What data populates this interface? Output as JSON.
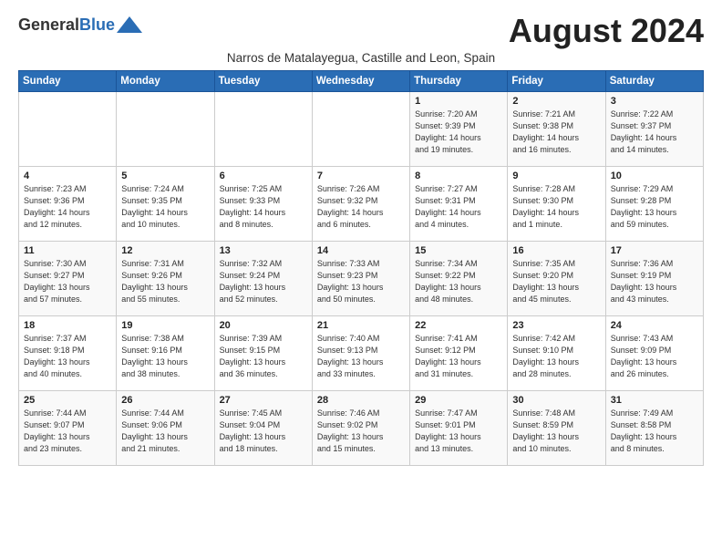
{
  "logo": {
    "general": "General",
    "blue": "Blue"
  },
  "title": "August 2024",
  "subtitle": "Narros de Matalayegua, Castille and Leon, Spain",
  "days_header": [
    "Sunday",
    "Monday",
    "Tuesday",
    "Wednesday",
    "Thursday",
    "Friday",
    "Saturday"
  ],
  "weeks": [
    [
      {
        "day": "",
        "info": ""
      },
      {
        "day": "",
        "info": ""
      },
      {
        "day": "",
        "info": ""
      },
      {
        "day": "",
        "info": ""
      },
      {
        "day": "1",
        "info": "Sunrise: 7:20 AM\nSunset: 9:39 PM\nDaylight: 14 hours\nand 19 minutes."
      },
      {
        "day": "2",
        "info": "Sunrise: 7:21 AM\nSunset: 9:38 PM\nDaylight: 14 hours\nand 16 minutes."
      },
      {
        "day": "3",
        "info": "Sunrise: 7:22 AM\nSunset: 9:37 PM\nDaylight: 14 hours\nand 14 minutes."
      }
    ],
    [
      {
        "day": "4",
        "info": "Sunrise: 7:23 AM\nSunset: 9:36 PM\nDaylight: 14 hours\nand 12 minutes."
      },
      {
        "day": "5",
        "info": "Sunrise: 7:24 AM\nSunset: 9:35 PM\nDaylight: 14 hours\nand 10 minutes."
      },
      {
        "day": "6",
        "info": "Sunrise: 7:25 AM\nSunset: 9:33 PM\nDaylight: 14 hours\nand 8 minutes."
      },
      {
        "day": "7",
        "info": "Sunrise: 7:26 AM\nSunset: 9:32 PM\nDaylight: 14 hours\nand 6 minutes."
      },
      {
        "day": "8",
        "info": "Sunrise: 7:27 AM\nSunset: 9:31 PM\nDaylight: 14 hours\nand 4 minutes."
      },
      {
        "day": "9",
        "info": "Sunrise: 7:28 AM\nSunset: 9:30 PM\nDaylight: 14 hours\nand 1 minute."
      },
      {
        "day": "10",
        "info": "Sunrise: 7:29 AM\nSunset: 9:28 PM\nDaylight: 13 hours\nand 59 minutes."
      }
    ],
    [
      {
        "day": "11",
        "info": "Sunrise: 7:30 AM\nSunset: 9:27 PM\nDaylight: 13 hours\nand 57 minutes."
      },
      {
        "day": "12",
        "info": "Sunrise: 7:31 AM\nSunset: 9:26 PM\nDaylight: 13 hours\nand 55 minutes."
      },
      {
        "day": "13",
        "info": "Sunrise: 7:32 AM\nSunset: 9:24 PM\nDaylight: 13 hours\nand 52 minutes."
      },
      {
        "day": "14",
        "info": "Sunrise: 7:33 AM\nSunset: 9:23 PM\nDaylight: 13 hours\nand 50 minutes."
      },
      {
        "day": "15",
        "info": "Sunrise: 7:34 AM\nSunset: 9:22 PM\nDaylight: 13 hours\nand 48 minutes."
      },
      {
        "day": "16",
        "info": "Sunrise: 7:35 AM\nSunset: 9:20 PM\nDaylight: 13 hours\nand 45 minutes."
      },
      {
        "day": "17",
        "info": "Sunrise: 7:36 AM\nSunset: 9:19 PM\nDaylight: 13 hours\nand 43 minutes."
      }
    ],
    [
      {
        "day": "18",
        "info": "Sunrise: 7:37 AM\nSunset: 9:18 PM\nDaylight: 13 hours\nand 40 minutes."
      },
      {
        "day": "19",
        "info": "Sunrise: 7:38 AM\nSunset: 9:16 PM\nDaylight: 13 hours\nand 38 minutes."
      },
      {
        "day": "20",
        "info": "Sunrise: 7:39 AM\nSunset: 9:15 PM\nDaylight: 13 hours\nand 36 minutes."
      },
      {
        "day": "21",
        "info": "Sunrise: 7:40 AM\nSunset: 9:13 PM\nDaylight: 13 hours\nand 33 minutes."
      },
      {
        "day": "22",
        "info": "Sunrise: 7:41 AM\nSunset: 9:12 PM\nDaylight: 13 hours\nand 31 minutes."
      },
      {
        "day": "23",
        "info": "Sunrise: 7:42 AM\nSunset: 9:10 PM\nDaylight: 13 hours\nand 28 minutes."
      },
      {
        "day": "24",
        "info": "Sunrise: 7:43 AM\nSunset: 9:09 PM\nDaylight: 13 hours\nand 26 minutes."
      }
    ],
    [
      {
        "day": "25",
        "info": "Sunrise: 7:44 AM\nSunset: 9:07 PM\nDaylight: 13 hours\nand 23 minutes."
      },
      {
        "day": "26",
        "info": "Sunrise: 7:44 AM\nSunset: 9:06 PM\nDaylight: 13 hours\nand 21 minutes."
      },
      {
        "day": "27",
        "info": "Sunrise: 7:45 AM\nSunset: 9:04 PM\nDaylight: 13 hours\nand 18 minutes."
      },
      {
        "day": "28",
        "info": "Sunrise: 7:46 AM\nSunset: 9:02 PM\nDaylight: 13 hours\nand 15 minutes."
      },
      {
        "day": "29",
        "info": "Sunrise: 7:47 AM\nSunset: 9:01 PM\nDaylight: 13 hours\nand 13 minutes."
      },
      {
        "day": "30",
        "info": "Sunrise: 7:48 AM\nSunset: 8:59 PM\nDaylight: 13 hours\nand 10 minutes."
      },
      {
        "day": "31",
        "info": "Sunrise: 7:49 AM\nSunset: 8:58 PM\nDaylight: 13 hours\nand 8 minutes."
      }
    ]
  ]
}
